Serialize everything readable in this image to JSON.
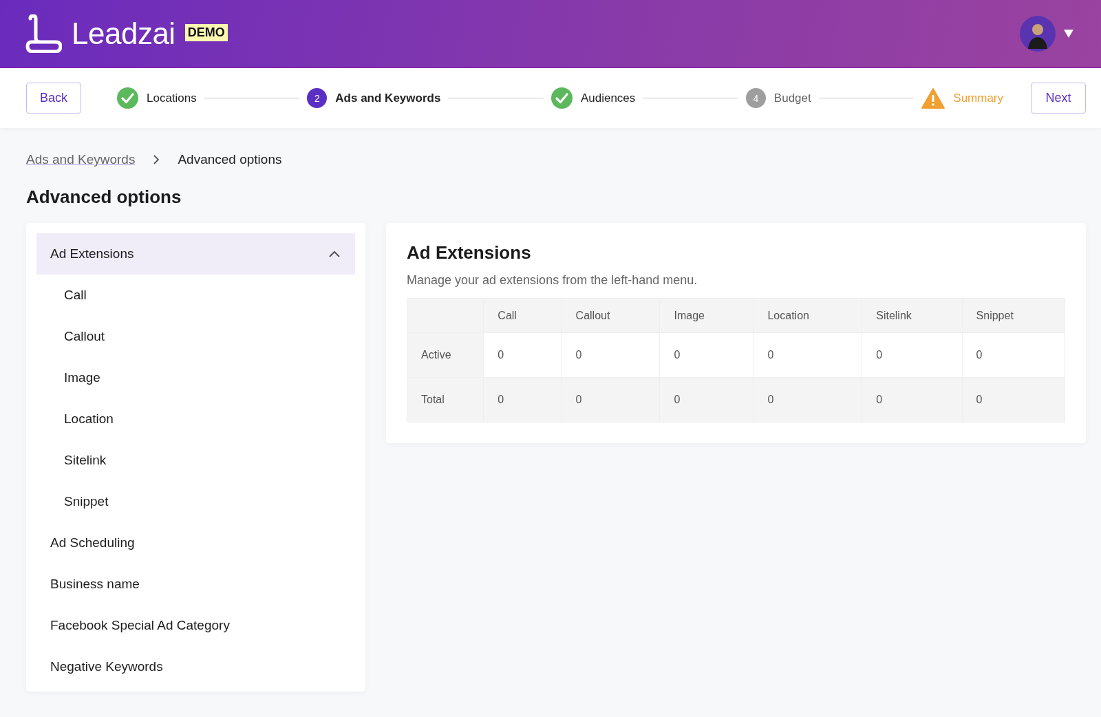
{
  "header": {
    "logo_text": "Leadzai",
    "badge": "DEMO"
  },
  "stepper": {
    "back": "Back",
    "next": "Next",
    "steps": [
      {
        "label": "Locations",
        "kind": "done"
      },
      {
        "label": "Ads and Keywords",
        "kind": "current",
        "number": "2"
      },
      {
        "label": "Audiences",
        "kind": "done"
      },
      {
        "label": "Budget",
        "kind": "pending",
        "number": "4"
      },
      {
        "label": "Summary",
        "kind": "warning"
      }
    ]
  },
  "breadcrumb": [
    {
      "label": "Ads and Keywords",
      "link": true
    },
    {
      "label": "Advanced options",
      "link": false
    }
  ],
  "page_title": "Advanced options",
  "sidebar": {
    "items": [
      {
        "label": "Ad Extensions",
        "expanded": true,
        "selected": true,
        "children": [
          {
            "label": "Call"
          },
          {
            "label": "Callout"
          },
          {
            "label": "Image"
          },
          {
            "label": "Location"
          },
          {
            "label": "Sitelink"
          },
          {
            "label": "Snippet"
          }
        ]
      },
      {
        "label": "Ad Scheduling",
        "selected": false
      },
      {
        "label": "Business name",
        "selected": false
      },
      {
        "label": "Facebook Special Ad Category",
        "selected": false
      },
      {
        "label": "Negative Keywords",
        "selected": false
      }
    ]
  },
  "panel": {
    "title": "Ad Extensions",
    "description": "Manage your ad extensions from the left-hand menu.",
    "table": {
      "columns": [
        "Call",
        "Callout",
        "Image",
        "Location",
        "Sitelink",
        "Snippet"
      ],
      "rows": [
        {
          "label": "Active",
          "values": [
            "0",
            "0",
            "0",
            "0",
            "0",
            "0"
          ]
        },
        {
          "label": "Total",
          "values": [
            "0",
            "0",
            "0",
            "0",
            "0",
            "0"
          ]
        }
      ]
    }
  }
}
